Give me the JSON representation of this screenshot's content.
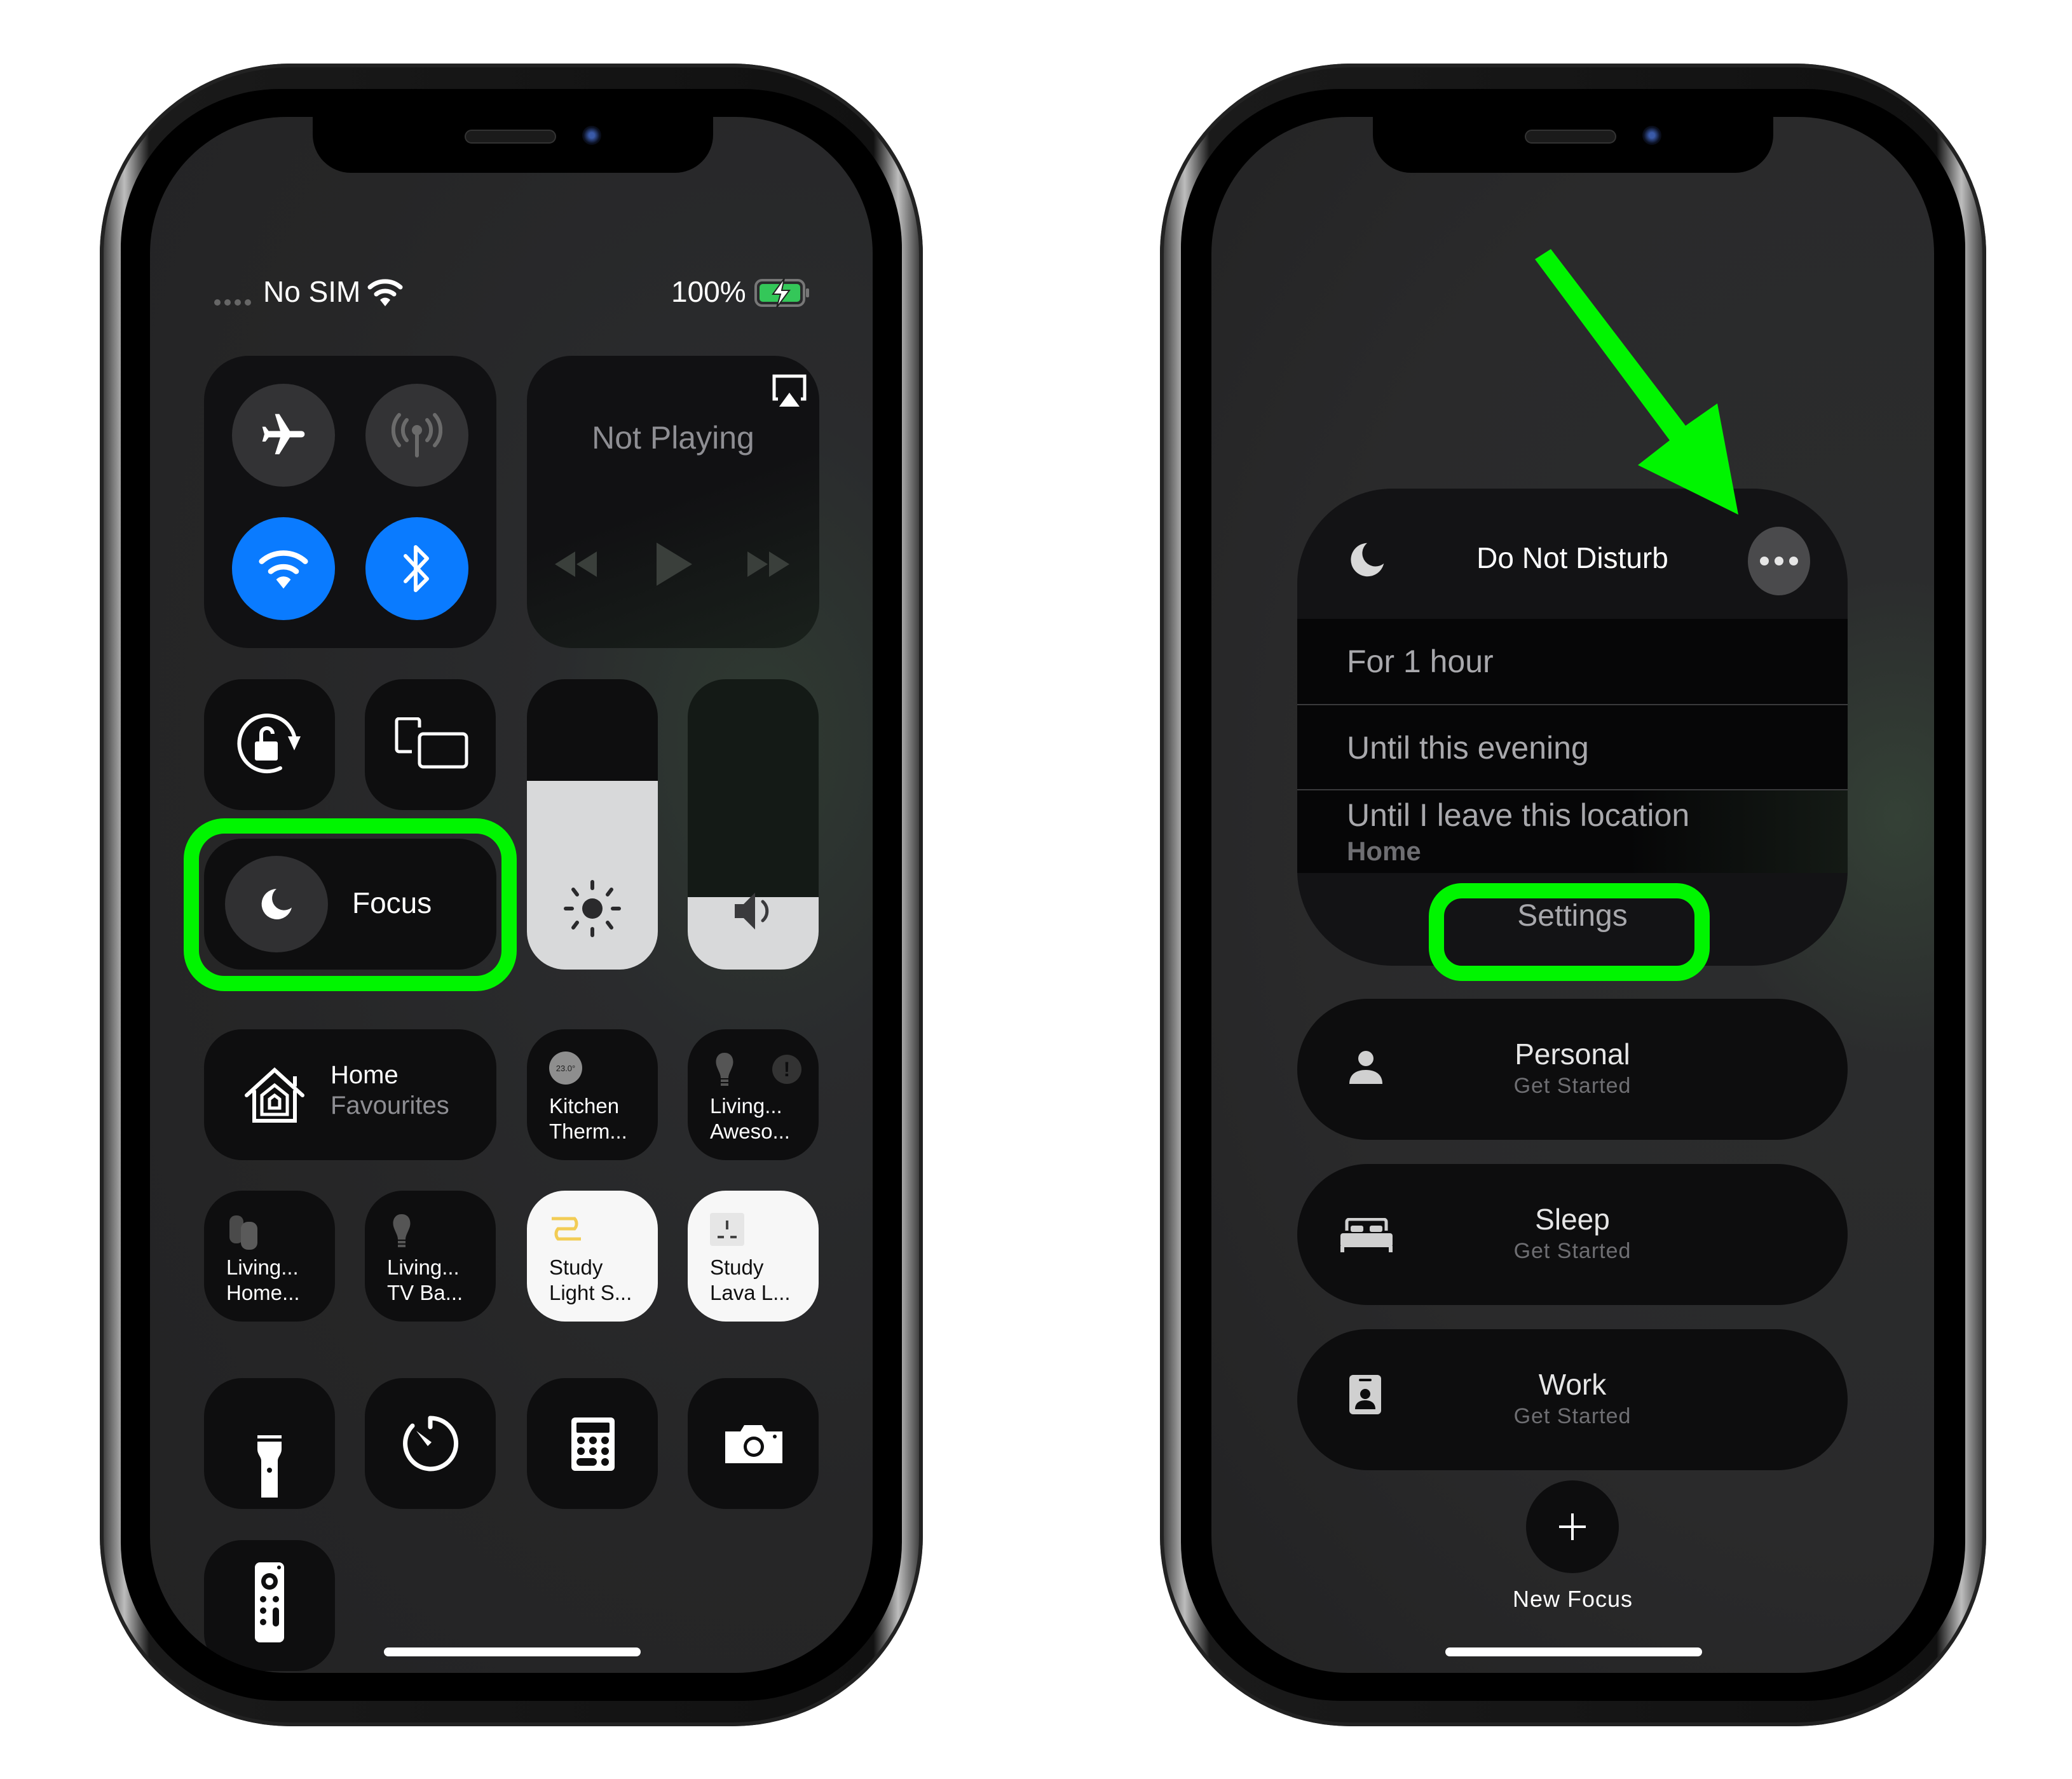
{
  "left_phone": {
    "status_bar": {
      "carrier": "No SIM",
      "battery": "100%",
      "icons": [
        "signal-dots-icon",
        "wifi-icon",
        "battery-charging-icon"
      ]
    },
    "connectivity": {
      "airplane": {
        "icon": "airplane-icon",
        "state": "off"
      },
      "cellular": {
        "icon": "antenna-icon",
        "state": "disabled"
      },
      "wifi": {
        "icon": "wifi-icon",
        "state": "on"
      },
      "bluetooth": {
        "icon": "bluetooth-icon",
        "state": "on"
      }
    },
    "now_playing": {
      "title": "Not Playing",
      "icons": [
        "airplay-icon",
        "rewind-icon",
        "play-icon",
        "fast-forward-icon"
      ]
    },
    "orientation_lock_icon": "rotation-lock-icon",
    "screen_mirroring_icon": "screen-mirroring-icon",
    "focus": {
      "label": "Focus",
      "icon": "moon-icon"
    },
    "brightness": {
      "icon": "sun-icon",
      "level": 0.65
    },
    "volume": {
      "icon": "speaker-icon",
      "level": 0.25
    },
    "home": {
      "title": "Home",
      "subtitle": "Favourites"
    },
    "home_tiles": [
      {
        "line1": "Kitchen",
        "line2": "Therm...",
        "badge": "23.0°",
        "active": false
      },
      {
        "line1": "Living...",
        "line2": "Aweso...",
        "icon": "lightbulb-icon",
        "alert": "!",
        "active": false
      },
      {
        "line1": "Living...",
        "line2": "Home...",
        "icon": "homepod-icon",
        "active": false
      },
      {
        "line1": "Living...",
        "line2": "TV Ba...",
        "icon": "lightbulb-icon",
        "active": false
      },
      {
        "line1": "Study",
        "line2": "Light S...",
        "icon": "lightstrip-icon",
        "active": true
      },
      {
        "line1": "Study",
        "line2": "Lava L...",
        "icon": "outlet-icon",
        "active": true
      }
    ],
    "tools": [
      "flashlight-icon",
      "timer-icon",
      "calculator-icon",
      "camera-icon",
      "apple-tv-remote-icon"
    ]
  },
  "right_phone": {
    "focus_menu": {
      "title": "Do Not Disturb",
      "options": [
        {
          "label": "For 1 hour"
        },
        {
          "label": "Until this evening"
        },
        {
          "label": "Until I leave this location",
          "sublabel": "Home"
        }
      ],
      "settings_label": "Settings"
    },
    "focus_modes": [
      {
        "name": "Personal",
        "status": "Get Started",
        "icon": "person-icon"
      },
      {
        "name": "Sleep",
        "status": "Get Started",
        "icon": "bed-icon"
      },
      {
        "name": "Work",
        "status": "Get Started",
        "icon": "id-badge-icon"
      }
    ],
    "new_focus_label": "New Focus"
  },
  "annotations": {
    "highlight_color": "#00f500",
    "accent_blue": "#0a7bff"
  }
}
